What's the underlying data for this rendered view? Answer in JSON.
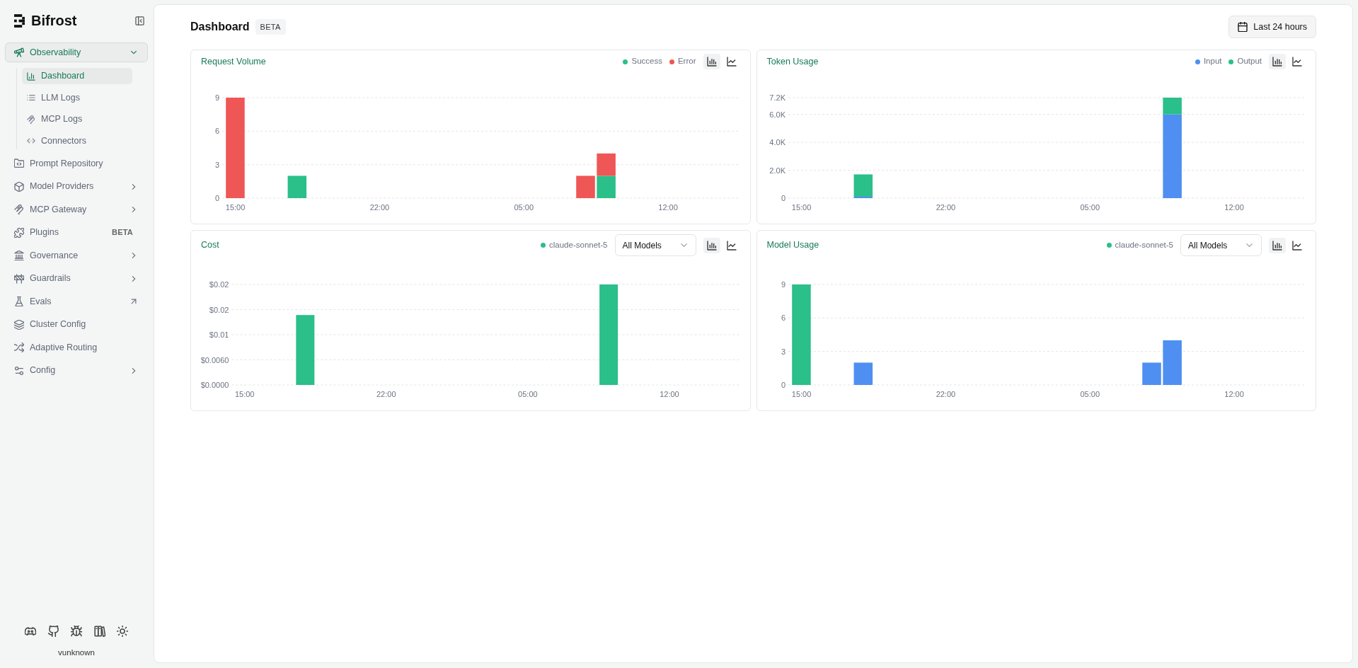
{
  "sidebar": {
    "brand": "Bifrost",
    "nav": [
      {
        "label": "Observability",
        "kind": "group",
        "expanded": true,
        "selected": true,
        "children": [
          {
            "label": "Dashboard",
            "selected": true
          },
          {
            "label": "LLM Logs",
            "selected": false
          },
          {
            "label": "MCP Logs",
            "selected": false
          },
          {
            "label": "Connectors",
            "selected": false
          }
        ]
      },
      {
        "label": "Prompt Repository",
        "kind": "link",
        "selected": false
      },
      {
        "label": "Model Providers",
        "kind": "group",
        "expanded": false,
        "selected": false
      },
      {
        "label": "MCP Gateway",
        "kind": "group",
        "expanded": false,
        "selected": false
      },
      {
        "label": "Plugins",
        "kind": "link",
        "selected": false,
        "badge": "BETA"
      },
      {
        "label": "Governance",
        "kind": "group",
        "expanded": false,
        "selected": false
      },
      {
        "label": "Guardrails",
        "kind": "group",
        "expanded": false,
        "selected": false
      },
      {
        "label": "Evals",
        "kind": "external",
        "selected": false
      },
      {
        "label": "Cluster Config",
        "kind": "link",
        "selected": false
      },
      {
        "label": "Adaptive Routing",
        "kind": "link",
        "selected": false
      },
      {
        "label": "Config",
        "kind": "group",
        "expanded": false,
        "selected": false
      }
    ],
    "version": "vunknown"
  },
  "header": {
    "title": "Dashboard",
    "badge": "BETA",
    "time_range": "Last 24 hours"
  },
  "panels": [
    {
      "title": "Request Volume",
      "views": [
        {
          "kind": "bar",
          "selected": true
        },
        {
          "kind": "line",
          "selected": false
        }
      ],
      "chart_data": {
        "type": "bar",
        "stacked": true,
        "grid": true,
        "categories": [
          "15:00",
          null,
          null,
          null,
          null,
          null,
          null,
          "22:00",
          null,
          null,
          null,
          null,
          null,
          null,
          "05:00",
          null,
          null,
          null,
          null,
          null,
          null,
          "12:00",
          null,
          null,
          null
        ],
        "series": [
          {
            "name": "Success",
            "color": "#2bbf8a",
            "values": [
              0,
              0,
              0,
              2,
              0,
              0,
              0,
              0,
              0,
              0,
              0,
              0,
              0,
              0,
              0,
              0,
              0,
              0,
              2,
              0,
              0,
              0,
              0,
              0,
              0
            ]
          },
          {
            "name": "Error",
            "color": "#ef5656",
            "values": [
              9,
              0,
              0,
              0,
              0,
              0,
              0,
              0,
              0,
              0,
              0,
              0,
              0,
              0,
              0,
              0,
              0,
              2,
              2,
              0,
              0,
              0,
              0,
              0,
              0
            ]
          }
        ],
        "ylim": [
          0,
          9
        ],
        "yticks": [
          0,
          3,
          6,
          9
        ]
      }
    },
    {
      "title": "Token Usage",
      "views": [
        {
          "kind": "bar",
          "selected": true
        },
        {
          "kind": "line",
          "selected": false
        }
      ],
      "chart_data": {
        "type": "bar",
        "stacked": true,
        "grid": true,
        "categories": [
          "15:00",
          null,
          null,
          null,
          null,
          null,
          null,
          "22:00",
          null,
          null,
          null,
          null,
          null,
          null,
          "05:00",
          null,
          null,
          null,
          null,
          null,
          null,
          "12:00",
          null,
          null,
          null
        ],
        "series": [
          {
            "name": "Input",
            "color": "#4e8ff1",
            "values": [
              0,
              0,
              0,
              100,
              0,
              0,
              0,
              0,
              0,
              0,
              0,
              0,
              0,
              0,
              0,
              0,
              0,
              0,
              6000,
              0,
              0,
              0,
              0,
              0,
              0
            ]
          },
          {
            "name": "Output",
            "color": "#2bbf8a",
            "values": [
              0,
              0,
              0,
              1600,
              0,
              0,
              0,
              0,
              0,
              0,
              0,
              0,
              0,
              0,
              0,
              0,
              0,
              0,
              1200,
              0,
              0,
              0,
              0,
              0,
              0
            ]
          }
        ],
        "ylim": [
          0,
          7200
        ],
        "yticks": [
          0,
          {
            "value": 2000,
            "label": "2.0K"
          },
          {
            "value": 4000,
            "label": "4.0K"
          },
          {
            "value": 6000,
            "label": "6.0K"
          },
          {
            "value": 7200,
            "label": "7.2K"
          }
        ]
      }
    },
    {
      "title": "Cost",
      "model_filter": "All Models",
      "views": [
        {
          "kind": "bar",
          "selected": true
        },
        {
          "kind": "line",
          "selected": false
        }
      ],
      "chart_data": {
        "type": "bar",
        "stacked": true,
        "grid": true,
        "categories": [
          "15:00",
          null,
          null,
          null,
          null,
          null,
          null,
          "22:00",
          null,
          null,
          null,
          null,
          null,
          null,
          "05:00",
          null,
          null,
          null,
          null,
          null,
          null,
          "12:00",
          null,
          null,
          null
        ],
        "series": [
          {
            "name": "claude-sonnet-5",
            "color": "#2bbf8a",
            "values": [
              0,
              0,
              0,
              0.0167,
              0,
              0,
              0,
              0,
              0,
              0,
              0,
              0,
              0,
              0,
              0,
              0,
              0,
              0,
              0.024,
              0,
              0,
              0,
              0,
              0,
              0
            ]
          }
        ],
        "ylim": [
          0,
          0.024
        ],
        "yticks": [
          {
            "value": 0,
            "label": "$0.0000"
          },
          {
            "value": 0.006,
            "label": "$0.0060"
          },
          {
            "value": 0.012,
            "label": "$0.01"
          },
          {
            "value": 0.018,
            "label": "$0.02"
          },
          {
            "value": 0.024,
            "label": "$0.02"
          }
        ]
      }
    },
    {
      "title": "Model Usage",
      "model_filter": "All Models",
      "views": [
        {
          "kind": "bar",
          "selected": true
        },
        {
          "kind": "line",
          "selected": false
        }
      ],
      "chart_data": {
        "type": "bar",
        "stacked": true,
        "grid": true,
        "categories": [
          "15:00",
          null,
          null,
          null,
          null,
          null,
          null,
          "22:00",
          null,
          null,
          null,
          null,
          null,
          null,
          "05:00",
          null,
          null,
          null,
          null,
          null,
          null,
          "12:00",
          null,
          null,
          null
        ],
        "series": [
          {
            "name": "claude-sonnet-5",
            "color": "#2bbf8a",
            "values": [
              9,
              0,
              0,
              0,
              0,
              0,
              0,
              0,
              0,
              0,
              0,
              0,
              0,
              0,
              0,
              0,
              0,
              0,
              0,
              0,
              0,
              0,
              0,
              0,
              0
            ]
          },
          {
            "color": "#4e8ff1",
            "values": [
              0,
              0,
              0,
              2,
              0,
              0,
              0,
              0,
              0,
              0,
              0,
              0,
              0,
              0,
              0,
              0,
              0,
              2,
              4,
              0,
              0,
              0,
              0,
              0,
              0
            ]
          }
        ],
        "ylim": [
          0,
          9
        ],
        "yticks": [
          0,
          3,
          6,
          9
        ]
      }
    }
  ]
}
